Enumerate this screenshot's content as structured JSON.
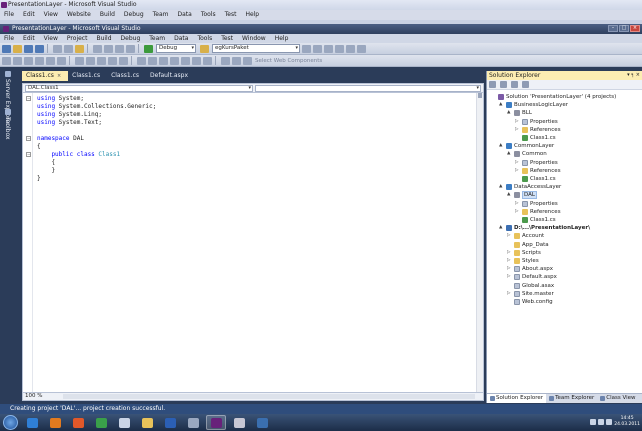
{
  "outer_window": {
    "title": "PresentationLayer - Microsoft Visual Studio",
    "menu": [
      "File",
      "Edit",
      "View",
      "Website",
      "Build",
      "Debug",
      "Team",
      "Data",
      "Tools",
      "Test",
      "Help"
    ]
  },
  "inner_window": {
    "title": "PresentationLayer - Microsoft Visual Studio",
    "menu": [
      "File",
      "Edit",
      "View",
      "Project",
      "Build",
      "Debug",
      "Team",
      "Data",
      "Tools",
      "Test",
      "Window",
      "Help"
    ]
  },
  "toolbar": {
    "config": "Debug",
    "search": "egKursPaket",
    "web_components": "Select Web Components"
  },
  "side_tabs": [
    "Server Explorer",
    "Toolbox"
  ],
  "doc_tabs": [
    {
      "label": "Class1.cs",
      "active": true
    },
    {
      "label": "Class1.cs",
      "active": false
    },
    {
      "label": "Class1.cs",
      "active": false
    },
    {
      "label": "Default.aspx",
      "active": false
    }
  ],
  "editor": {
    "nav_left": "DAL.Class1",
    "nav_right": "",
    "code": [
      {
        "a": "using",
        "b": " System;"
      },
      {
        "a": "using",
        "b": " System.Collections.Generic;"
      },
      {
        "a": "using",
        "b": " System.Linq;"
      },
      {
        "a": "using",
        "b": " System.Text;"
      },
      {
        "a": "",
        "b": ""
      },
      {
        "a": "namespace",
        "b": " DAL"
      },
      {
        "a": "",
        "b": "{"
      },
      {
        "a": "    public class",
        "b": " Class1"
      },
      {
        "a": "",
        "b": "    {"
      },
      {
        "a": "",
        "b": "    }"
      },
      {
        "a": "",
        "b": "}"
      }
    ],
    "zoom": "100 %"
  },
  "solution_explorer": {
    "title": "Solution Explorer",
    "items": [
      {
        "label": "Solution 'PresentationLayer' (4 projects)",
        "level": 0,
        "icon": "sln",
        "tw": ""
      },
      {
        "label": "BusinessLogicLayer",
        "level": 1,
        "icon": "proj",
        "tw": "▲"
      },
      {
        "label": "BLL",
        "level": 2,
        "icon": "ref",
        "tw": "▲"
      },
      {
        "label": "Properties",
        "level": 3,
        "icon": "file",
        "tw": "▷"
      },
      {
        "label": "References",
        "level": 3,
        "icon": "folder",
        "tw": "▷"
      },
      {
        "label": "Class1.cs",
        "level": 3,
        "icon": "cs",
        "tw": ""
      },
      {
        "label": "CommonLayer",
        "level": 1,
        "icon": "proj",
        "tw": "▲"
      },
      {
        "label": "Common",
        "level": 2,
        "icon": "ref",
        "tw": "▲"
      },
      {
        "label": "Properties",
        "level": 3,
        "icon": "file",
        "tw": "▷"
      },
      {
        "label": "References",
        "level": 3,
        "icon": "folder",
        "tw": "▷"
      },
      {
        "label": "Class1.cs",
        "level": 3,
        "icon": "cs",
        "tw": ""
      },
      {
        "label": "DataAccessLayer",
        "level": 1,
        "icon": "proj",
        "tw": "▲"
      },
      {
        "label": "DAL",
        "level": 2,
        "icon": "ref",
        "tw": "▲",
        "selected": true
      },
      {
        "label": "Properties",
        "level": 3,
        "icon": "file",
        "tw": "▷"
      },
      {
        "label": "References",
        "level": 3,
        "icon": "folder",
        "tw": "▷"
      },
      {
        "label": "Class1.cs",
        "level": 3,
        "icon": "cs",
        "tw": ""
      },
      {
        "label": "D:\\...\\PresentationLayer\\",
        "level": 1,
        "icon": "web",
        "tw": "▲",
        "bold": true
      },
      {
        "label": "Account",
        "level": 2,
        "icon": "folder",
        "tw": "▷"
      },
      {
        "label": "App_Data",
        "level": 2,
        "icon": "folder",
        "tw": ""
      },
      {
        "label": "Scripts",
        "level": 2,
        "icon": "folder",
        "tw": "▷"
      },
      {
        "label": "Styles",
        "level": 2,
        "icon": "folder",
        "tw": "▷"
      },
      {
        "label": "About.aspx",
        "level": 2,
        "icon": "file",
        "tw": "▷"
      },
      {
        "label": "Default.aspx",
        "level": 2,
        "icon": "file",
        "tw": "▷"
      },
      {
        "label": "Global.asax",
        "level": 2,
        "icon": "file",
        "tw": ""
      },
      {
        "label": "Site.master",
        "level": 2,
        "icon": "file",
        "tw": "▷"
      },
      {
        "label": "Web.config",
        "level": 2,
        "icon": "file",
        "tw": ""
      }
    ],
    "tabs": [
      "Solution Explorer",
      "Team Explorer",
      "Class View"
    ]
  },
  "status": "Creating project 'DAL'... project creation successful.",
  "taskbar": {
    "apps": [
      {
        "name": "ie-icon",
        "color": "#2f7fd6"
      },
      {
        "name": "media-player-icon",
        "color": "#e27a1f"
      },
      {
        "name": "firefox-icon",
        "color": "#e1582a"
      },
      {
        "name": "chrome-icon",
        "color": "#3aa04a"
      },
      {
        "name": "documents-icon",
        "color": "#c9d4e6"
      },
      {
        "name": "folder-icon",
        "color": "#e8c25a"
      },
      {
        "name": "word-icon",
        "color": "#2b5fb5"
      },
      {
        "name": "explorer-icon",
        "color": "#9aa8c0"
      },
      {
        "name": "visual-studio-icon",
        "color": "#68217a"
      },
      {
        "name": "paint-icon",
        "color": "#c7c7d4"
      },
      {
        "name": "app-icon",
        "color": "#3a6fb0"
      }
    ],
    "clock_time": "14:45",
    "clock_date": "24.03.2011"
  }
}
